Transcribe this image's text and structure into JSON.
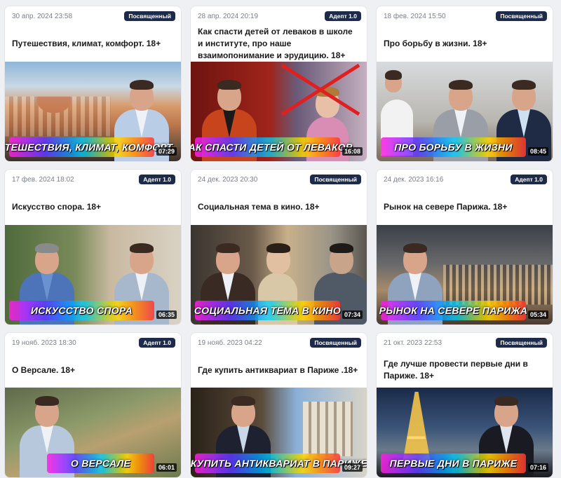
{
  "cards": [
    {
      "date": "30 апр. 2024 23:58",
      "badge": "Посвященный",
      "title": "Путешествия, климат, комфорт. 18+",
      "banner": "ПУТЕШЕСТВИЯ, КЛИМАТ, КОМФОРТ",
      "duration": "07:29"
    },
    {
      "date": "28 апр. 2024 20:19",
      "badge": "Адепт 1.0",
      "title": "Как спасти детей от леваков в школе и институте, про наше взаимопонимание и эрудицию. 18+",
      "banner": "КАК СПАСТИ ДЕТЕЙ ОТ ЛЕВАКОВ",
      "duration": "16:08"
    },
    {
      "date": "18 фев. 2024 15:50",
      "badge": "Посвященный",
      "title": "Про борьбу в жизни. 18+",
      "banner": "ПРО БОРЬБУ В ЖИЗНИ",
      "duration": "08:45"
    },
    {
      "date": "17 фев. 2024 18:02",
      "badge": "Адепт 1.0",
      "title": "Искусство спора. 18+",
      "banner": "ИСКУССТВО СПОРА",
      "duration": "06:35"
    },
    {
      "date": "24 дек. 2023 20:30",
      "badge": "Посвященный",
      "title": "Социальная тема в кино. 18+",
      "banner": "СОЦИАЛЬНАЯ ТЕМА В КИНО",
      "duration": "07:34"
    },
    {
      "date": "24 дек. 2023 16:16",
      "badge": "Адепт 1.0",
      "title": "Рынок на севере Парижа. 18+",
      "banner": "РЫНОК НА СЕВЕРЕ ПАРИЖА",
      "duration": "05:34"
    },
    {
      "date": "19 нояб. 2023 18:30",
      "badge": "Адепт 1.0",
      "title": "О Версале. 18+",
      "banner": "О ВЕРСАЛЕ",
      "duration": "06:01"
    },
    {
      "date": "19 нояб. 2023 04:22",
      "badge": "Посвященный",
      "title": "Где купить антиквариат в Париже .18+",
      "banner": "ГДЕ КУПИТЬ АНТИКВАРИАТ В ПАРИЖЕ",
      "duration": "09:27"
    },
    {
      "date": "21 окт. 2023 22:53",
      "badge": "Посвященный",
      "title": "Где лучше провести первые дни в Париже. 18+",
      "banner": "ПЕРВЫЕ ДНИ В ПАРИЖЕ",
      "duration": "07:16"
    }
  ],
  "colors": {
    "badge_bg": "#1d2a4a",
    "card_bg": "#ffffff",
    "page_bg": "#eef0f4"
  }
}
